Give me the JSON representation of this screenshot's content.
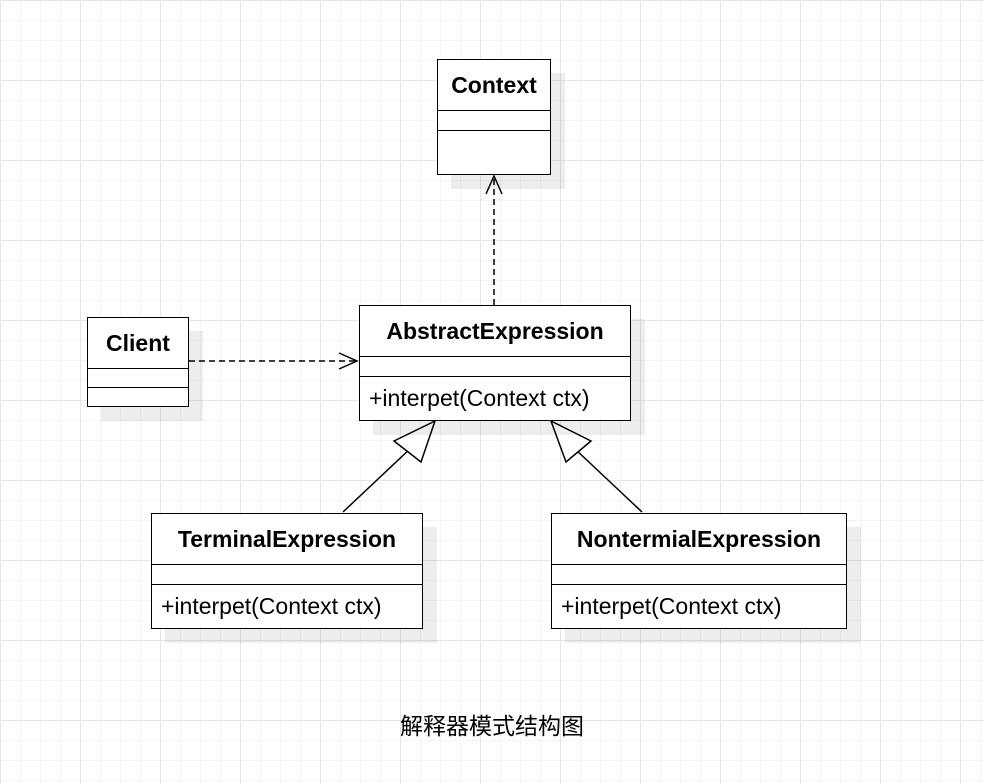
{
  "diagram": {
    "caption": "解释器模式结构图",
    "classes": {
      "context": {
        "name": "Context",
        "operation": ""
      },
      "client": {
        "name": "Client",
        "operation": ""
      },
      "abstract_expression": {
        "name": "AbstractExpression",
        "operation": "+interpet(Context ctx)"
      },
      "terminal_expression": {
        "name": "TerminalExpression",
        "operation": "+interpet(Context ctx)"
      },
      "nonterminal_expression": {
        "name": "NontermialExpression",
        "operation": "+interpet(Context ctx)"
      }
    },
    "relations": [
      {
        "type": "dependency",
        "from": "Client",
        "to": "AbstractExpression"
      },
      {
        "type": "dependency",
        "from": "AbstractExpression",
        "to": "Context"
      },
      {
        "type": "generalization",
        "from": "TerminalExpression",
        "to": "AbstractExpression"
      },
      {
        "type": "generalization",
        "from": "NontermialExpression",
        "to": "AbstractExpression"
      }
    ]
  }
}
